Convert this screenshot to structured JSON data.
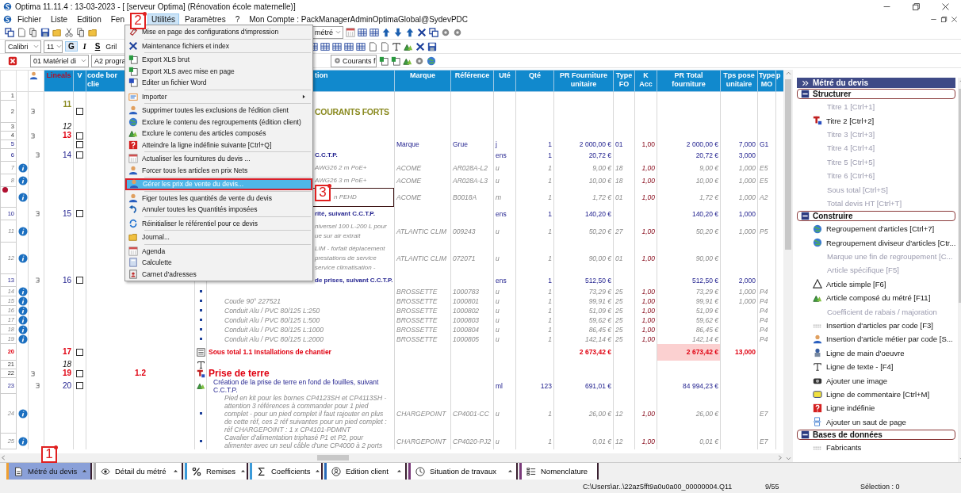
{
  "window": {
    "title": "Optima 11.11.4 : 13-03-2023 - [ [serveur Optima] (Rénovation école maternelle)]"
  },
  "menubar": [
    {
      "label": "Fichier",
      "selected": false
    },
    {
      "label": "Liste",
      "selected": false
    },
    {
      "label": "Edition",
      "selected": false
    },
    {
      "label": "Fen",
      "selected": false
    },
    {
      "label": "Utilités",
      "selected": true,
      "callout": "2"
    },
    {
      "label": "Paramètres",
      "selected": false
    },
    {
      "label": "?",
      "selected": false
    },
    {
      "label": "Mon Compte : PackManagerAdminOptimaGlobal@SydevPDC",
      "selected": false
    }
  ],
  "menu": {
    "items": [
      {
        "kind": "item",
        "label": "Mise en page des configurations d'impression",
        "selected": false
      },
      {
        "kind": "separator"
      },
      {
        "kind": "item",
        "label": "Maintenance fichiers et index",
        "selected": false
      },
      {
        "kind": "separator"
      },
      {
        "kind": "item",
        "label": "Export XLS brut",
        "selected": false
      },
      {
        "kind": "item",
        "label": "Export XLS avec mise en page",
        "selected": false
      },
      {
        "kind": "item",
        "label": "Editer un fichier Word",
        "selected": false
      },
      {
        "kind": "separator"
      },
      {
        "kind": "item",
        "label": "Importer",
        "selected": false,
        "submenu": true
      },
      {
        "kind": "separator"
      },
      {
        "kind": "item",
        "label": "Supprimer toutes les exclusions de l'édition client",
        "selected": false
      },
      {
        "kind": "item",
        "label": "Exclure le contenu des regroupements (édition client)",
        "selected": false
      },
      {
        "kind": "item",
        "label": "Exclure le contenu des articles composés",
        "selected": false
      },
      {
        "kind": "item",
        "label": "Atteindre la ligne indéfinie suivante [Ctrl+Q]",
        "selected": false
      },
      {
        "kind": "separator"
      },
      {
        "kind": "item",
        "label": "Actualiser les fournitures du devis ...",
        "selected": false
      },
      {
        "kind": "item",
        "label": "Forcer tous les articles en prix Nets",
        "selected": false
      },
      {
        "kind": "separator"
      },
      {
        "kind": "item",
        "label": "Gérer les prix de vente du devis...",
        "selected": true,
        "callout": "3"
      },
      {
        "kind": "separator"
      },
      {
        "kind": "item",
        "label": "Figer toutes les quantités de vente du devis",
        "selected": false
      },
      {
        "kind": "item",
        "label": "Annuler toutes les Quantités imposées",
        "selected": false
      },
      {
        "kind": "separator"
      },
      {
        "kind": "item",
        "label": "Réinitialiser le référentiel pour ce devis",
        "selected": false
      },
      {
        "kind": "separator"
      },
      {
        "kind": "item",
        "label": "Journal...",
        "selected": false
      },
      {
        "kind": "separator"
      },
      {
        "kind": "item",
        "label": "Agenda",
        "selected": false
      },
      {
        "kind": "item",
        "label": "Calculette",
        "selected": false
      },
      {
        "kind": "item",
        "label": "Carnet d'adresses",
        "selected": false
      }
    ]
  },
  "toolbars": {
    "view_combo": "métré",
    "font_combo": "Calibri",
    "size_combo": "11",
    "bold": "G",
    "italic": "I",
    "strike": "S",
    "grid_label": "Gril",
    "lot_combo": "01 Matériel di",
    "prog_combo": "A2 progra",
    "current_combo": "Courants f"
  },
  "table": {
    "columns": [
      "Lineals",
      "V",
      "code bor\nclie",
      "tion",
      "Marque",
      "Référence",
      "Uté",
      "Qté",
      "PR Fourniture\nunitaire",
      "Type\nFO",
      "K\nAcc",
      "PR Total\nfourniture",
      "Tps pose\nunitaire",
      "Type\nMO",
      "p"
    ],
    "rows": [
      {
        "n": "1",
        "kind": "blank",
        "selected": false
      },
      {
        "n": "2",
        "kind": "chapter",
        "selected": false,
        "expanded": true,
        "line": "11",
        "checked": false,
        "design": "COURANTS FORTS"
      },
      {
        "n": "3",
        "kind": "text",
        "selected": false,
        "line": "12"
      },
      {
        "n": "4",
        "kind": "title",
        "selected": false,
        "expanded": true,
        "line": "13",
        "checked": false
      },
      {
        "n": "5",
        "kind": "group",
        "selected": false,
        "checked": false,
        "marque": "Marque",
        "ref": "Grue",
        "ute": "j",
        "qte": "1",
        "pru": "2 000,00 €",
        "tfo": "01",
        "kacc": "1,00",
        "prt": "2 000,00 €",
        "tps": "7,000",
        "tmo": "G1"
      },
      {
        "n": "6",
        "kind": "group",
        "selected": false,
        "expanded": true,
        "line": "14",
        "checked": false,
        "design": "C.C.T.P.",
        "ute": "ens",
        "qte": "1",
        "pru": "20,72 €",
        "prt": "20,72 €",
        "tps": "3,000"
      },
      {
        "n": "7",
        "kind": "item",
        "selected": false,
        "info": true,
        "design": "AWG26 2 m PoE+",
        "marque": "ACOME",
        "ref": "AR028A-L2",
        "ute": "u",
        "qte": "1",
        "pru": "9,00 €",
        "tfo": "18",
        "kacc": "1,00",
        "prt": "9,00 €",
        "tps": "1,000",
        "tmo": "E5"
      },
      {
        "n": "8",
        "kind": "item",
        "selected": false,
        "info": true,
        "design": "AWG26 3 m PoE+",
        "marque": "ACOME",
        "ref": "AR028A-L3",
        "ute": "u",
        "qte": "1",
        "pru": "10,00 €",
        "tfo": "18",
        "kacc": "1,00",
        "prt": "10,00 €",
        "tps": "1,000",
        "tmo": "E5"
      },
      {
        "kind": "item",
        "selected": true,
        "info": true,
        "design": "n PEHD",
        "marque": "ACOME",
        "ref": "B0018A",
        "ute": "m",
        "qte": "1",
        "pru": "1,72 €",
        "tfo": "01",
        "kacc": "1,00",
        "prt": "1,72 €",
        "tps": "1,000",
        "tmo": "A2"
      },
      {
        "n": "10",
        "kind": "group",
        "selected": false,
        "expanded": true,
        "line": "15",
        "checked": false,
        "design": "rité, suivant C.C.T.P.",
        "ute": "ens",
        "qte": "1",
        "pru": "140,20 €",
        "prt": "140,20 €",
        "tps": "1,000"
      },
      {
        "n": "11",
        "kind": "item",
        "selected": false,
        "info": true,
        "design": "niversel 100 L-200 L pour\nue sur air extrait",
        "marque": "ATLANTIC CLIM",
        "ref": "009243",
        "ute": "u",
        "qte": "1",
        "pru": "50,20 €",
        "tfo": "27",
        "kacc": "1,00",
        "prt": "50,20 €",
        "tps": "1,000",
        "tmo": "P5"
      },
      {
        "n": "12",
        "kind": "item",
        "selected": false,
        "info": true,
        "design": "LIM - forfait déplacement\nprestations de service\nservice climatisation -",
        "marque": "ATLANTIC CLIM",
        "ref": "072071",
        "ute": "u",
        "qte": "1",
        "pru": "90,00 €",
        "tfo": "01",
        "kacc": "1,00",
        "prt": "90,00 €"
      },
      {
        "n": "13",
        "kind": "group",
        "selected": false,
        "expanded": true,
        "line": "16",
        "checked": false,
        "design": "de prises, suivant C.C.T.P.",
        "ute": "ens",
        "qte": "1",
        "pru": "512,50 €",
        "prt": "512,50 €",
        "tps": "2,000"
      },
      {
        "n": "14",
        "kind": "item",
        "selected": false,
        "info": true,
        "marque": "BROSSETTE",
        "ref": "1000783",
        "ute": "u",
        "qte": "1",
        "pru": "73,29 €",
        "tfo": "25",
        "kacc": "1,00",
        "prt": "73,29 €",
        "tps": "1,000",
        "tmo": "P4"
      },
      {
        "n": "15",
        "kind": "item",
        "selected": false,
        "info": true,
        "design": "Coude 90° 227521",
        "marque": "BROSSETTE",
        "ref": "1000801",
        "ute": "u",
        "qte": "1",
        "pru": "99,91 €",
        "tfo": "25",
        "kacc": "1,00",
        "prt": "99,91 €",
        "tps": "1,000",
        "tmo": "P4"
      },
      {
        "n": "16",
        "kind": "item",
        "selected": false,
        "info": true,
        "design": "Conduit Alu / PVC 80/125 L:250",
        "marque": "BROSSETTE",
        "ref": "1000802",
        "ute": "u",
        "qte": "1",
        "pru": "51,09 €",
        "tfo": "25",
        "kacc": "1,00",
        "prt": "51,09 €",
        "tmo": "P4"
      },
      {
        "n": "17",
        "kind": "item",
        "selected": false,
        "info": true,
        "design": "Conduit Alu / PVC 80/125 L:500",
        "marque": "BROSSETTE",
        "ref": "1000803",
        "ute": "u",
        "qte": "1",
        "pru": "59,62 €",
        "tfo": "25",
        "kacc": "1,00",
        "prt": "59,62 €",
        "tmo": "P4"
      },
      {
        "n": "18",
        "kind": "item",
        "selected": false,
        "info": true,
        "design": "Conduit Alu / PVC 80/125 L:1000",
        "marque": "BROSSETTE",
        "ref": "1000804",
        "ute": "u",
        "qte": "1",
        "pru": "86,45 €",
        "tfo": "25",
        "kacc": "1,00",
        "prt": "86,45 €",
        "tmo": "P4"
      },
      {
        "n": "19",
        "kind": "item",
        "selected": false,
        "info": true,
        "design": "Conduit Alu / PVC 80/125 L:2000",
        "marque": "BROSSETTE",
        "ref": "1000805",
        "ute": "u",
        "qte": "1",
        "pru": "142,14 €",
        "tfo": "25",
        "kacc": "1,00",
        "prt": "142,14 €",
        "tmo": "P4"
      },
      {
        "n": "20",
        "kind": "subtotal",
        "selected": false,
        "line": "17",
        "checked": false,
        "design": "Sous total 1.1 Installations de chantier",
        "pru": "2 673,42 €",
        "prt": "2 673,42 €",
        "tps": "13,000"
      },
      {
        "n": "21",
        "kind": "text",
        "selected": false,
        "line": "18"
      },
      {
        "n": "22",
        "kind": "title",
        "selected": false,
        "expanded": true,
        "line": "19",
        "checked": false,
        "code": "1.2",
        "design": "Prise de terre"
      },
      {
        "n": "23",
        "kind": "compound",
        "selected": false,
        "expanded": true,
        "line": "20",
        "checked": false,
        "design": "Création de la prise de terre en fond de fouilles, suivant C.C.T.P.",
        "ute": "ml",
        "qte": "123",
        "pru": "691,01 €",
        "prt": "84 994,23 €"
      },
      {
        "n": "24",
        "kind": "item",
        "selected": false,
        "info": true,
        "design": "Pied en kit pour les bornes CP4123SH et CP4113SH - attention 3 références à commander pour 1 pied complet - pour un pied complet il faut rajouter en plus de cette réf, ces 2 réf suivantes pour un pied complet : réf CHARGEPOINT : 1 x CP4101-PDMNT",
        "marque": "CHARGEPOINT",
        "ref": "CP4001-CC",
        "ute": "u",
        "qte": "1",
        "pru": "26,00 €",
        "tfo": "12",
        "kacc": "1,00",
        "prt": "26,00 €",
        "tmo": "E7"
      },
      {
        "n": "25",
        "kind": "item",
        "selected": false,
        "info": true,
        "design": "Cavalier d'alimentation triphasé P1 et P2, pour\nalimenter avec un seul câble d'une CP4000 à 2 ports",
        "marque": "CHARGEPOINT",
        "ref": "CP4020-PJ2",
        "ute": "u",
        "qte": "1",
        "pru": "0,01 €",
        "tfo": "12",
        "kacc": "1,00",
        "prt": "0,01 €",
        "tmo": "E7"
      }
    ]
  },
  "panel": {
    "title": "Métré du devis",
    "sections": [
      {
        "title": "Structurer",
        "expanded": true,
        "items": [
          {
            "label": "Titre 1 [Ctrl+1]",
            "disabled": true
          },
          {
            "label": "Titre 2 [Ctrl+2]",
            "disabled": false
          },
          {
            "label": "Titre 3 [Ctrl+3]",
            "disabled": true
          },
          {
            "label": "Titre 4 [Ctrl+4]",
            "disabled": true
          },
          {
            "label": "Titre 5 [Ctrl+5]",
            "disabled": true
          },
          {
            "label": "Titre 6 [Ctrl+6]",
            "disabled": true
          },
          {
            "label": "Sous total [Ctrl+S]",
            "disabled": true
          },
          {
            "label": "Total devis HT [Ctrl+T]",
            "disabled": true
          }
        ]
      },
      {
        "title": "Construire",
        "expanded": true,
        "items": [
          {
            "label": "Regroupement d'articles  [Ctrl+7]",
            "disabled": false
          },
          {
            "label": "Regroupement diviseur d'articles [Ctr...",
            "disabled": false
          },
          {
            "label": "Marque une fin de regroupement  [C...",
            "disabled": true
          },
          {
            "label": "Article spécifique [F5]",
            "disabled": true
          },
          {
            "label": "Article simple [F6]",
            "disabled": false
          },
          {
            "label": "Article composé du métré [F11]",
            "disabled": false
          },
          {
            "label": "Coefficient de rabais / majoration",
            "disabled": true
          },
          {
            "label": "Insertion d'articles par code [F3]",
            "disabled": false
          },
          {
            "label": "Insertion d'article métier par code [S...",
            "disabled": false
          },
          {
            "label": "Ligne de main d'oeuvre",
            "disabled": false
          },
          {
            "label": "Ligne de texte - [F4]",
            "disabled": false
          },
          {
            "label": "Ajouter une image",
            "disabled": false
          },
          {
            "label": "Ligne de commentaire [Ctrl+M]",
            "disabled": false
          },
          {
            "label": "Ligne indéfinie",
            "disabled": false
          },
          {
            "label": "Ajouter un saut de page",
            "disabled": false
          }
        ]
      },
      {
        "title": "Bases de données",
        "expanded": true,
        "items": [
          {
            "label": "Fabricants",
            "disabled": false
          }
        ]
      }
    ]
  },
  "tabs": [
    {
      "label": "Métré du devis",
      "selected": true,
      "color": "#f0a030",
      "callout": "1"
    },
    {
      "label": "Détail du métré",
      "selected": false,
      "color": "#b0b0b0"
    },
    {
      "label": "Remises",
      "selected": false,
      "color": "#3a9ad9"
    },
    {
      "label": "Coefficients",
      "selected": false,
      "color": "#3a9ad9"
    },
    {
      "label": "Edition client",
      "selected": false,
      "color": "#2a6ab9"
    },
    {
      "label": "Situation de travaux",
      "selected": false,
      "color": "#7a3a7a"
    },
    {
      "label": "Nomenclature",
      "selected": false,
      "color": "#7a3a7a"
    }
  ],
  "status_bar": {
    "path": "C:\\Users\\ar..\\22az5fft9a0u0a00_00000004.Q11",
    "position": "9/55",
    "selection": "Sélection : 0"
  }
}
